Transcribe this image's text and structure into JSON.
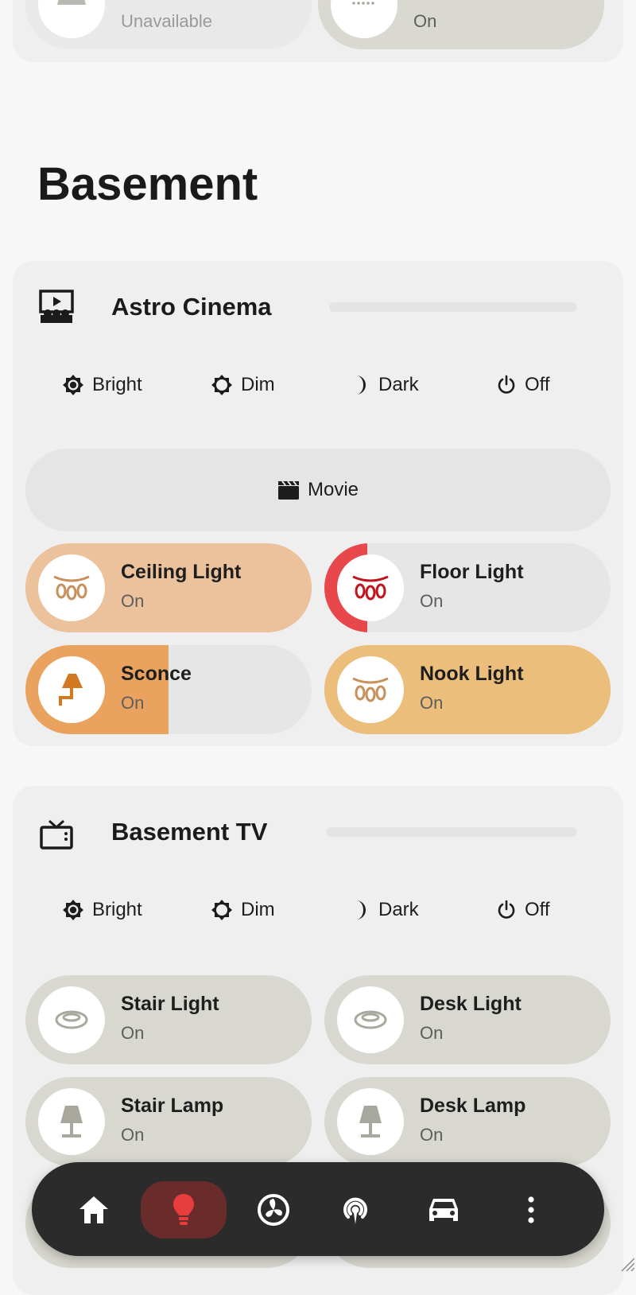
{
  "top_section": {
    "tile_left": {
      "state": "Unavailable"
    },
    "tile_right": {
      "state": "On"
    }
  },
  "area": {
    "title": "Basement"
  },
  "cinema": {
    "title": "Astro Cinema",
    "scenes": [
      {
        "label": "Bright",
        "icon": "bright-icon"
      },
      {
        "label": "Dim",
        "icon": "dim-icon"
      },
      {
        "label": "Dark",
        "icon": "moon-icon"
      },
      {
        "label": "Off",
        "icon": "power-icon"
      }
    ],
    "movie_label": "Movie",
    "tiles": [
      {
        "name": "Ceiling Light",
        "state": "On",
        "icon": "string-lights-icon",
        "brightness": 1.0,
        "color": "#ecc29c"
      },
      {
        "name": "Floor Light",
        "state": "On",
        "icon": "string-lights-icon",
        "brightness": 0.15,
        "color": "#e8484b"
      },
      {
        "name": "Sconce",
        "state": "On",
        "icon": "wall-sconce-icon",
        "brightness": 0.5,
        "color": "#eaa35e"
      },
      {
        "name": "Nook Light",
        "state": "On",
        "icon": "string-lights-icon",
        "brightness": 1.0,
        "color": "#ecbe7c"
      }
    ]
  },
  "tv": {
    "title": "Basement TV",
    "scenes": [
      {
        "label": "Bright",
        "icon": "bright-icon"
      },
      {
        "label": "Dim",
        "icon": "dim-icon"
      },
      {
        "label": "Dark",
        "icon": "moon-icon"
      },
      {
        "label": "Off",
        "icon": "power-icon"
      }
    ],
    "tiles": [
      {
        "name": "Stair Light",
        "state": "On",
        "icon": "ceiling-light-icon",
        "color": "#d8d8d0"
      },
      {
        "name": "Desk Light",
        "state": "On",
        "icon": "ceiling-light-icon",
        "color": "#d8d8d0"
      },
      {
        "name": "Stair Lamp",
        "state": "On",
        "icon": "lamp-icon",
        "color": "#d8d8d0"
      },
      {
        "name": "Desk Lamp",
        "state": "On",
        "icon": "lamp-icon",
        "color": "#d8d8d0"
      }
    ]
  },
  "colors": {
    "active_nav": "#6a2b2b",
    "active_nav_icon": "#e83d3d",
    "ceiling_icon": "#c8905a",
    "floor_icon": "#c0141e",
    "sconce_icon": "#d27820",
    "nook_icon": "#c8905a",
    "neutral_icon": "#a9a89e"
  },
  "nav": [
    {
      "name": "home",
      "icon": "home-icon",
      "active": false
    },
    {
      "name": "lights",
      "icon": "lightbulb-icon",
      "active": true
    },
    {
      "name": "climate",
      "icon": "fan-icon",
      "active": false
    },
    {
      "name": "media",
      "icon": "broadcast-icon",
      "active": false
    },
    {
      "name": "car",
      "icon": "car-icon",
      "active": false
    },
    {
      "name": "more",
      "icon": "more-vertical-icon",
      "active": false
    }
  ]
}
